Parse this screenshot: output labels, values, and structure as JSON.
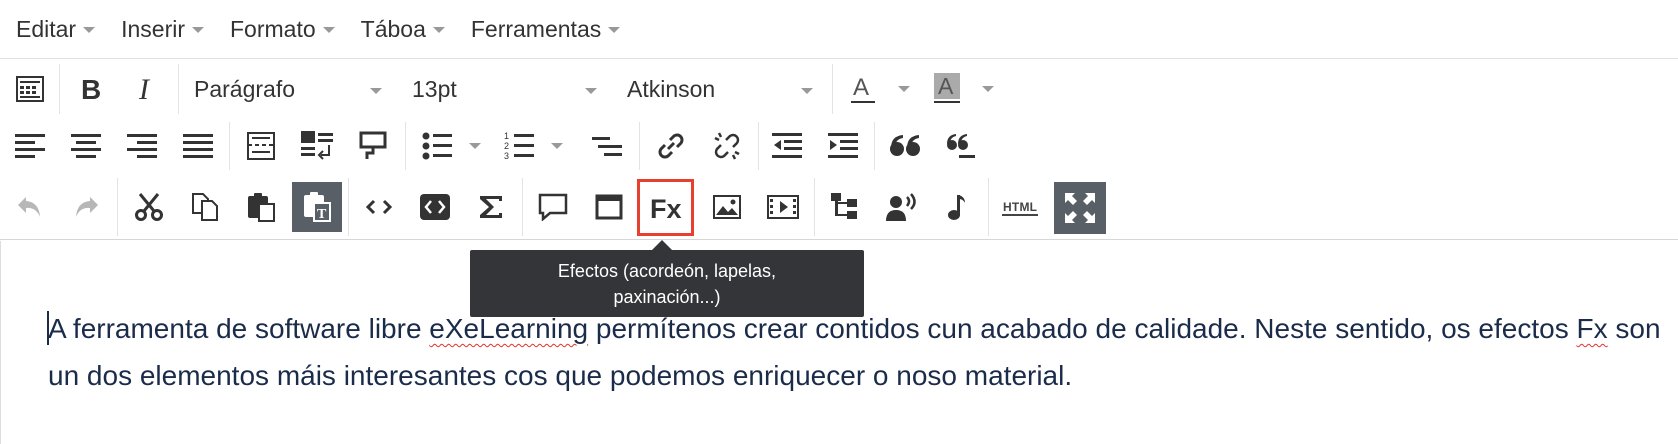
{
  "menubar": {
    "items": [
      {
        "label": "Editar"
      },
      {
        "label": "Inserir"
      },
      {
        "label": "Formato"
      },
      {
        "label": "Táboa"
      },
      {
        "label": "Ferramentas"
      }
    ]
  },
  "toolbar": {
    "block_format": "Parágrafo",
    "font_size": "13pt",
    "font_family": "Atkinson",
    "font_color_letter": "A",
    "bg_color_letter": "A",
    "fx_label": "Fx",
    "html_label": "HTML"
  },
  "tooltip": {
    "line1": "Efectos (acordeón, lapelas,",
    "line2": "paxinación...)"
  },
  "editor": {
    "part1": "A ferramenta de software libre ",
    "word_exe": "eXeLearning",
    "part2": " permítenos crear contidos cun acabado de calidade. Neste sentido, os efectos ",
    "word_fx": "Fx",
    "part3": " son un dos elementos máis interesantes cos que podemos enriquecer o noso material."
  },
  "colors": {
    "accent_highlight": "#e8402e",
    "active_button": "#595f66",
    "tooltip_bg": "#333538",
    "text": "#1b2b4a"
  }
}
